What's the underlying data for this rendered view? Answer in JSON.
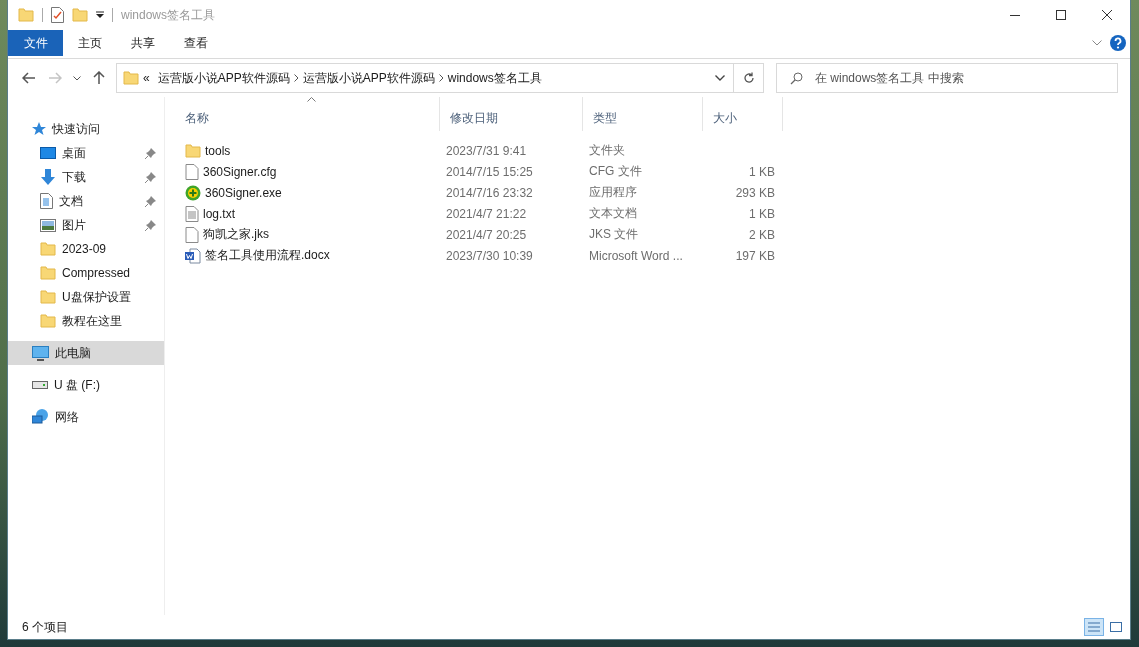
{
  "window": {
    "title": "windows签名工具"
  },
  "ribbon": {
    "tabs": [
      {
        "label": "文件",
        "kind": "file"
      },
      {
        "label": "主页",
        "kind": "tab"
      },
      {
        "label": "共享",
        "kind": "tab"
      },
      {
        "label": "查看",
        "kind": "tab"
      }
    ]
  },
  "nav_buttons": [
    {
      "kind": "back",
      "disabled": false
    },
    {
      "kind": "forward",
      "disabled": true
    },
    {
      "kind": "recent",
      "disabled": false
    },
    {
      "kind": "up",
      "disabled": false
    }
  ],
  "address": {
    "overflow": "«",
    "segments": [
      "运营版小说APP软件源码",
      "运营版小说APP软件源码",
      "windows签名工具"
    ]
  },
  "search": {
    "placeholder": "在 windows签名工具 中搜索"
  },
  "sidebar": {
    "items": [
      {
        "label": "快速访问",
        "kind": "star",
        "selected": false,
        "children": [
          {
            "label": "桌面",
            "kind": "desktop",
            "pinned": true,
            "selected": false
          },
          {
            "label": "下载",
            "kind": "download",
            "pinned": true,
            "selected": false
          },
          {
            "label": "文档",
            "kind": "document",
            "pinned": true,
            "selected": false
          },
          {
            "label": "图片",
            "kind": "picture",
            "pinned": true,
            "selected": false
          },
          {
            "label": "2023-09",
            "kind": "folder",
            "pinned": false,
            "selected": false
          },
          {
            "label": "Compressed",
            "kind": "folder",
            "pinned": false,
            "selected": false
          },
          {
            "label": "U盘保护设置",
            "kind": "folder",
            "pinned": false,
            "selected": false
          },
          {
            "label": "教程在这里",
            "kind": "folder",
            "pinned": false,
            "selected": false
          }
        ]
      },
      {
        "label": "此电脑",
        "kind": "pc",
        "selected": true
      },
      {
        "label": "U 盘 (F:)",
        "kind": "drive",
        "selected": false
      },
      {
        "label": "网络",
        "kind": "network",
        "selected": false
      }
    ]
  },
  "table": {
    "columns": [
      {
        "label": "名称",
        "sorted": true
      },
      {
        "label": "修改日期",
        "sorted": false
      },
      {
        "label": "类型",
        "sorted": false
      },
      {
        "label": "大小",
        "sorted": false
      }
    ],
    "rows": [
      {
        "kind": "folder",
        "name": "tools",
        "date": "2023/7/31 9:41",
        "type": "文件夹"
      },
      {
        "kind": "file",
        "name": "360Signer.cfg",
        "date": "2014/7/15 15:25",
        "type": "CFG 文件",
        "size": "1 KB"
      },
      {
        "kind": "exe",
        "name": "360Signer.exe",
        "date": "2014/7/16 23:32",
        "type": "应用程序",
        "size": "293 KB"
      },
      {
        "kind": "text",
        "name": "log.txt",
        "date": "2021/4/7 21:22",
        "type": "文本文档",
        "size": "1 KB"
      },
      {
        "kind": "file",
        "name": "狗凯之家.jks",
        "date": "2021/4/7 20:25",
        "type": "JKS 文件",
        "size": "2 KB"
      },
      {
        "kind": "word",
        "name": "签名工具使用流程.docx",
        "date": "2023/7/30 10:39",
        "type": "Microsoft Word ...",
        "size": "197 KB"
      }
    ]
  },
  "status_bar": {
    "item_count": "6 个项目",
    "views": [
      {
        "kind": "details",
        "selected": true
      },
      {
        "kind": "thumbnails",
        "selected": false
      }
    ]
  }
}
